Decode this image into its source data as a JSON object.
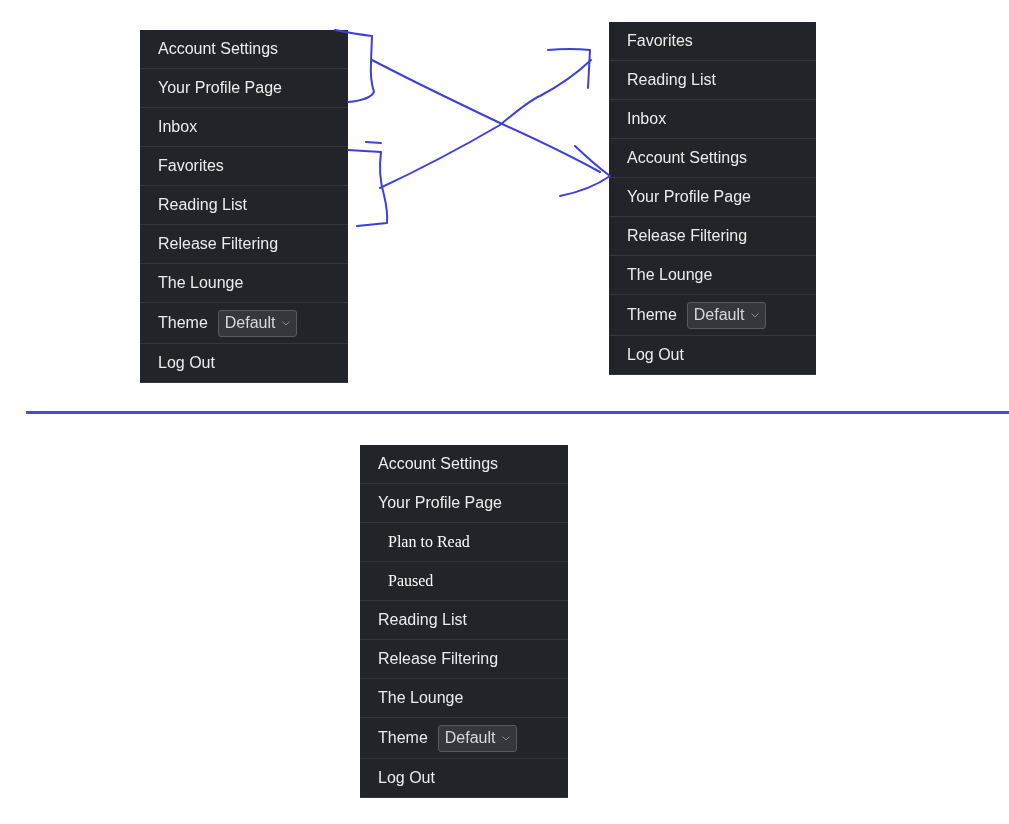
{
  "menus": [
    {
      "items": [
        {
          "kind": "link",
          "label": "Account Settings"
        },
        {
          "kind": "link",
          "label": "Your Profile Page"
        },
        {
          "kind": "link",
          "label": "Inbox"
        },
        {
          "kind": "link",
          "label": "Favorites"
        },
        {
          "kind": "link",
          "label": "Reading List"
        },
        {
          "kind": "link",
          "label": "Release Filtering"
        },
        {
          "kind": "link",
          "label": "The Lounge"
        },
        {
          "kind": "theme",
          "label": "Theme",
          "value": "Default"
        },
        {
          "kind": "link",
          "label": "Log Out"
        }
      ]
    },
    {
      "items": [
        {
          "kind": "link",
          "label": "Favorites"
        },
        {
          "kind": "link",
          "label": "Reading List"
        },
        {
          "kind": "link",
          "label": "Inbox"
        },
        {
          "kind": "link",
          "label": "Account Settings"
        },
        {
          "kind": "link",
          "label": "Your Profile Page"
        },
        {
          "kind": "link",
          "label": "Release Filtering"
        },
        {
          "kind": "link",
          "label": "The Lounge"
        },
        {
          "kind": "theme",
          "label": "Theme",
          "value": "Default"
        },
        {
          "kind": "link",
          "label": "Log Out"
        }
      ]
    },
    {
      "items": [
        {
          "kind": "link",
          "label": "Account Settings"
        },
        {
          "kind": "link",
          "label": "Your Profile Page"
        },
        {
          "kind": "sub",
          "label": "Plan to Read"
        },
        {
          "kind": "sub",
          "label": "Paused"
        },
        {
          "kind": "link",
          "label": "Reading List"
        },
        {
          "kind": "link",
          "label": "Release Filtering"
        },
        {
          "kind": "link",
          "label": "The Lounge"
        },
        {
          "kind": "theme",
          "label": "Theme",
          "value": "Default"
        },
        {
          "kind": "link",
          "label": "Log Out"
        }
      ]
    }
  ]
}
